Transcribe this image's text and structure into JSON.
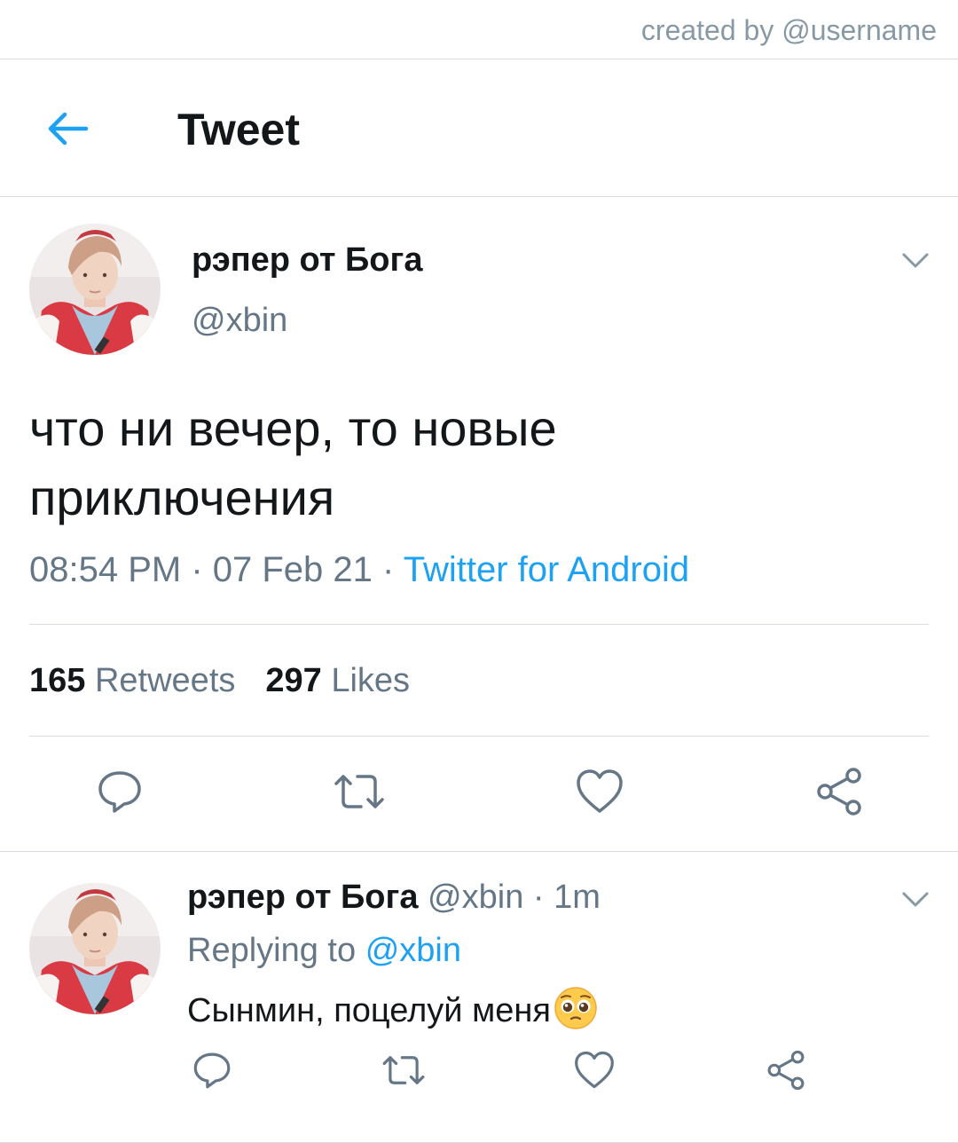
{
  "watermark": {
    "credit": "created by @username"
  },
  "header": {
    "title": "Tweet",
    "back_icon": "arrow-left-icon"
  },
  "tweet": {
    "author_name": "рэпер от Бога",
    "author_handle": "@xbin",
    "text_line1": "что ни вечер, то новые",
    "text_line2": "приключения",
    "time": "08:54 PM",
    "sep1": " · ",
    "date": "07 Feb 21",
    "sep2": " · ",
    "source": "Twitter for Android",
    "retweets_count": "165",
    "retweets_label": "Retweets",
    "likes_count": "297",
    "likes_label": "Likes",
    "actions": [
      "reply-icon",
      "retweet-icon",
      "like-icon",
      "share-icon"
    ]
  },
  "reply": {
    "author_name": "рэпер от Бога",
    "author_handle": "@xbin",
    "dot": " · ",
    "time_ago": "1m",
    "replying_label": "Replying to",
    "replying_handle": "@xbin",
    "text": "Сынмин, поцелуй меня",
    "emoji": "pleading-face-emoji"
  },
  "colors": {
    "accent": "#1da1f2",
    "secondary_text": "#657786",
    "primary_text": "#14171a",
    "divider": "#d9dde1"
  }
}
